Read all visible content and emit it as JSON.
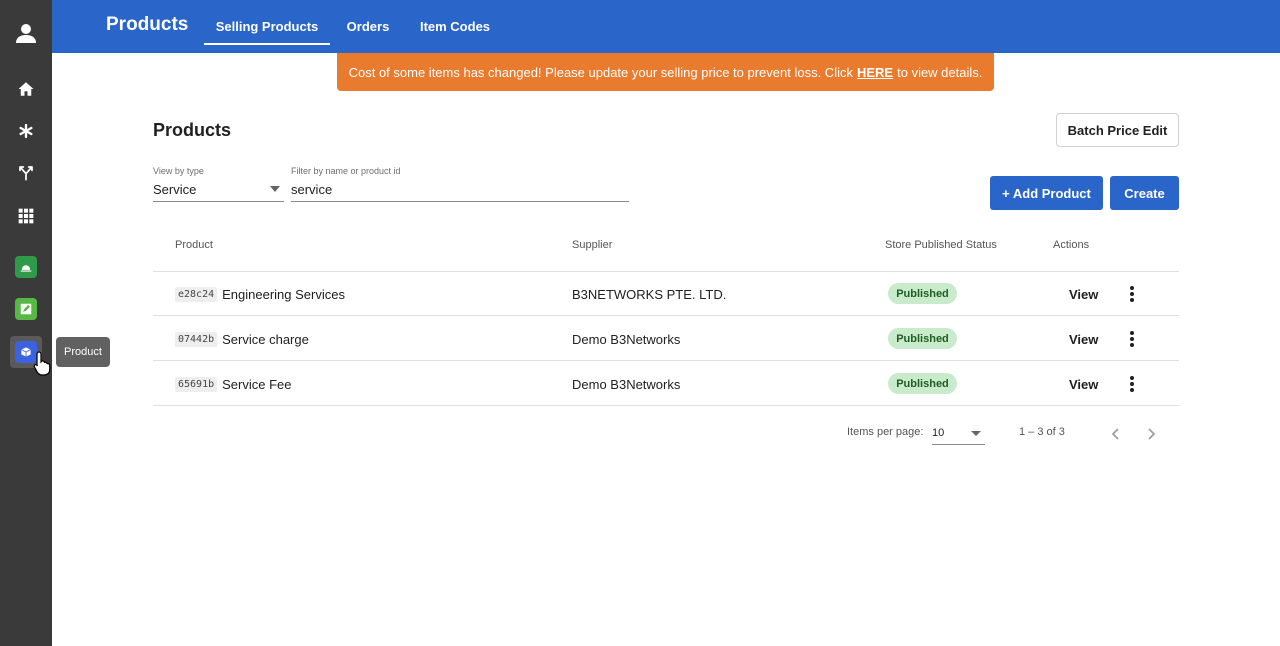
{
  "rail": {
    "items": [
      {
        "icon": "user-avatar-icon",
        "label": "Account"
      },
      {
        "icon": "home-icon",
        "label": "Home"
      },
      {
        "icon": "asterisk-icon",
        "label": "Settings"
      },
      {
        "icon": "routing-icon",
        "label": "Routing"
      },
      {
        "icon": "apps-grid-icon",
        "label": "Apps"
      },
      {
        "icon": "green-app-icon",
        "label": "App"
      },
      {
        "icon": "edit-note-app-icon",
        "label": "App"
      },
      {
        "icon": "product-app-icon",
        "label": "Product"
      }
    ],
    "tooltip": "Product"
  },
  "header": {
    "title": "Products",
    "tabs": [
      {
        "label": "Selling Products",
        "active": true
      },
      {
        "label": "Orders",
        "active": false
      },
      {
        "label": "Item Codes",
        "active": false
      }
    ]
  },
  "banner": {
    "text_before": "Cost of some items has changed! Please update your selling price to prevent loss. Click",
    "link": "HERE",
    "text_after": "to view details."
  },
  "main": {
    "title": "Products",
    "batch_button": "Batch Price Edit",
    "add_button": "+ Add Product",
    "create_button": "Create",
    "filters": {
      "type_label": "View by type",
      "type_value": "Service",
      "search_label": "Filter by name or product id",
      "search_value": "service"
    },
    "table": {
      "columns": [
        "Product",
        "Supplier",
        "Store Published Status",
        "Actions"
      ],
      "rows": [
        {
          "code": "e28c24",
          "name": "Engineering Services",
          "supplier": "B3NETWORKS PTE. LTD.",
          "status": "Published",
          "action": "View"
        },
        {
          "code": "07442b",
          "name": "Service charge",
          "supplier": "Demo B3Networks",
          "status": "Published",
          "action": "View"
        },
        {
          "code": "65691b",
          "name": "Service Fee",
          "supplier": "Demo B3Networks",
          "status": "Published",
          "action": "View"
        }
      ]
    },
    "pager": {
      "items_label": "Items per page:",
      "page_size": "10",
      "range": "1 – 3 of 3"
    }
  },
  "colors": {
    "primary": "#2a65c9",
    "banner": "#e87b2e",
    "rail": "#3a3a3a",
    "badge_bg": "#c9ebcc",
    "badge_text": "#1e5e22"
  }
}
